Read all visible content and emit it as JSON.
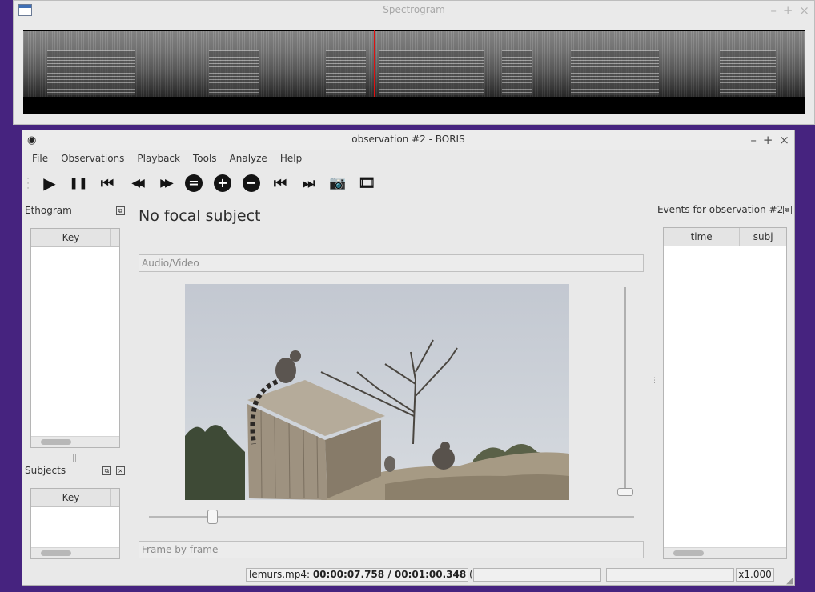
{
  "spectrogram_window": {
    "title": "Spectrogram",
    "buttons": [
      "–",
      "+",
      "×"
    ],
    "cursor_fraction": 0.448
  },
  "main_window": {
    "title": "observation #2 - BORIS",
    "buttons": [
      "–",
      "+",
      "×"
    ],
    "icon": "eye-icon"
  },
  "menu": [
    "File",
    "Observations",
    "Playback",
    "Tools",
    "Analyze",
    "Help"
  ],
  "toolbar": [
    {
      "name": "play-icon",
      "glyph": "▶"
    },
    {
      "name": "pause-icon",
      "glyph": "❚❚"
    },
    {
      "name": "skip-to-start-icon",
      "glyph": "⏮"
    },
    {
      "name": "rewind-icon",
      "glyph": "◀◀"
    },
    {
      "name": "fast-forward-icon",
      "glyph": "▶▶"
    },
    {
      "name": "reset-speed-icon",
      "glyph": "="
    },
    {
      "name": "speed-up-icon",
      "glyph": "+"
    },
    {
      "name": "slow-down-icon",
      "glyph": "−"
    },
    {
      "name": "previous-media-icon",
      "glyph": "⏮"
    },
    {
      "name": "next-media-icon",
      "glyph": "⏭"
    },
    {
      "name": "camera-icon",
      "glyph": "📷"
    },
    {
      "name": "film-icon",
      "glyph": "🎞"
    }
  ],
  "ethogram": {
    "title": "Ethogram",
    "columns": [
      "Key"
    ]
  },
  "subjects": {
    "title": "Subjects",
    "columns": [
      "Key"
    ]
  },
  "focal_subject": "No focal subject",
  "audio_video_label": "Audio/Video",
  "frame_by_frame_label": "Frame by frame",
  "events": {
    "title": "Events for observation #2",
    "columns": [
      "time",
      "subj"
    ]
  },
  "status": {
    "file": "lemurs.mp4:",
    "position": "00:00:07.758 / 00:01:00.348",
    "state": "(paused)",
    "speed": "x1.000"
  },
  "video_position_fraction": 0.13,
  "volume_fraction": 0.0
}
